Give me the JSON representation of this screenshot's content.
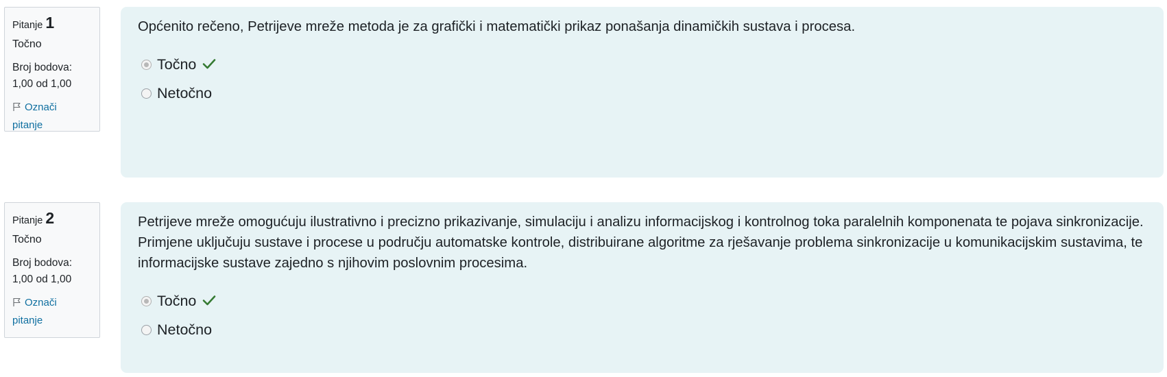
{
  "questions": [
    {
      "label": "Pitanje",
      "number": "1",
      "state": "Točno",
      "grade_label": "Broj bodova:",
      "grade_value": "1,00 od 1,00",
      "flag_label_1": "Označi",
      "flag_label_2": "pitanje",
      "text": "Općenito rečeno, Petrijeve mreže metoda je za grafički i matematički prikaz ponašanja dinamičkih sustava i procesa.",
      "options": [
        {
          "label": "Točno",
          "selected": true,
          "correct": true
        },
        {
          "label": "Netočno",
          "selected": false,
          "correct": false
        }
      ]
    },
    {
      "label": "Pitanje",
      "number": "2",
      "state": "Točno",
      "grade_label": "Broj bodova:",
      "grade_value": "1,00 od 1,00",
      "flag_label_1": "Označi",
      "flag_label_2": "pitanje",
      "text": "Petrijeve mreže omogućuju ilustrativno i precizno prikazivanje, simulaciju i analizu informacijskog i kontrolnog toka paralelnih komponenata te pojava sinkronizacije. Primjene uključuju sustave i procese u području automatske kontrole, distribuirane algoritme za rješavanje problema sinkronizacije u komunikacijskim sustavima, te informacijske sustave zajedno s njihovim poslovnim procesima.",
      "options": [
        {
          "label": "Točno",
          "selected": true,
          "correct": true
        },
        {
          "label": "Netočno",
          "selected": false,
          "correct": false
        }
      ]
    }
  ],
  "icons": {
    "flag": "flag-icon",
    "correct": "check-icon"
  },
  "colors": {
    "content_bg": "#e7f3f5",
    "info_bg": "#f8f9fa",
    "link": "#0f6fa0",
    "correct": "#357a32"
  }
}
